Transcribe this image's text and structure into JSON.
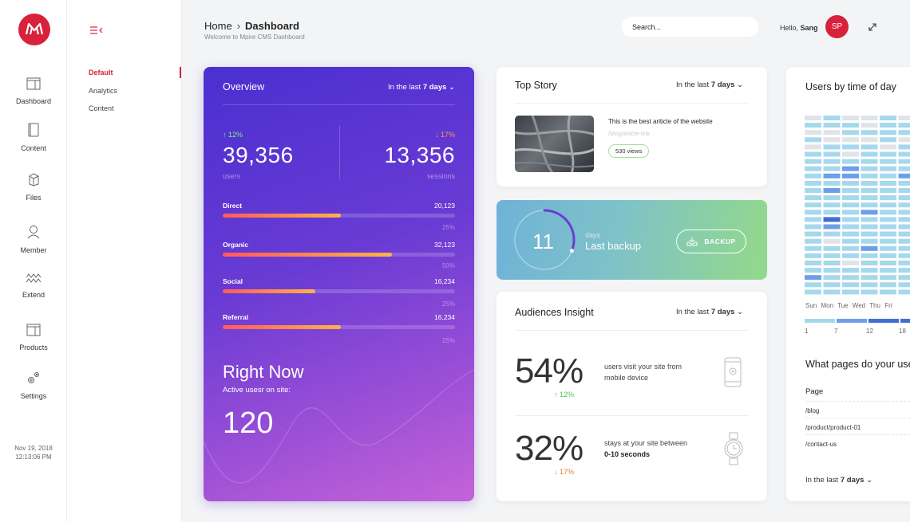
{
  "brand": {
    "accent": "#d8213b"
  },
  "rail": {
    "items": [
      {
        "label": "Dashboard",
        "icon": "dashboard-icon"
      },
      {
        "label": "Content",
        "icon": "content-icon"
      },
      {
        "label": "Files",
        "icon": "files-icon"
      },
      {
        "label": "Member",
        "icon": "member-icon"
      },
      {
        "label": "Extend",
        "icon": "extend-icon"
      },
      {
        "label": "Products",
        "icon": "products-icon"
      },
      {
        "label": "Settings",
        "icon": "settings-icon"
      }
    ],
    "date": "Nov 19, 2018",
    "time": "12:13:06 PM"
  },
  "submenu": {
    "items": [
      {
        "label": "Default",
        "active": true
      },
      {
        "label": "Analytics",
        "active": false
      },
      {
        "label": "Content",
        "active": false
      }
    ]
  },
  "header": {
    "breadcrumb_home": "Home",
    "breadcrumb_sep": "›",
    "breadcrumb_current": "Dashboard",
    "welcome": "Welcome to Mpire CMS Dashboard",
    "search_placeholder": "Search...",
    "hello_prefix": "Hello,",
    "user_name": "Sang",
    "avatar_initials": "SP"
  },
  "period": {
    "prefix": "In the last",
    "value": "7 days"
  },
  "overview": {
    "title": "Overview",
    "users": {
      "trend": "12%",
      "value": "39,356",
      "label": "users"
    },
    "sessions": {
      "trend": "17%",
      "value": "13,356",
      "label": "sessions"
    },
    "channels": [
      {
        "name": "Direct",
        "value": "20,123",
        "pct": "25%",
        "fill": 0.51
      },
      {
        "name": "Organic",
        "value": "32,123",
        "pct": "50%",
        "fill": 0.73
      },
      {
        "name": "Social",
        "value": "16,234",
        "pct": "25%",
        "fill": 0.4
      },
      {
        "name": "Referral",
        "value": "16,234",
        "pct": "25%",
        "fill": 0.51
      }
    ],
    "right_now_title": "Right Now",
    "right_now_sub": "Active usesr on site:",
    "right_now_value": "120"
  },
  "top_story": {
    "title": "Top Story",
    "headline": "This is the best ariticle of the website",
    "link": "/blog/article-link",
    "views": "530 views"
  },
  "backup": {
    "value": "11",
    "unit": "days",
    "label": "Last backup",
    "button": "BACKUP",
    "progress": 0.31
  },
  "audiences": {
    "title": "Audiences Insight",
    "mobile": {
      "value": "54%",
      "trend": "12%",
      "text_a": "users visit your site from",
      "text_b": "mobile device"
    },
    "stay": {
      "value": "32%",
      "trend": "17%",
      "text_a": "stays at your site between",
      "text_b": "0-10 seconds"
    }
  },
  "users_time": {
    "title": "Users by time of day",
    "days": "Sun Mon Tue Wed Thu Fri",
    "hours": [
      "1",
      "7",
      "12",
      "18"
    ],
    "colors": {
      "none": "#e1e3e6",
      "low": "#a6d8ec",
      "mid": "#6f9ee8",
      "high": "#3f6fd2"
    },
    "grid": [
      [
        "none",
        "low",
        "none",
        "none",
        "low",
        "none"
      ],
      [
        "low",
        "low",
        "low",
        "none",
        "low",
        "low"
      ],
      [
        "none",
        "none",
        "low",
        "low",
        "low",
        "low"
      ],
      [
        "low",
        "none",
        "none",
        "none",
        "low",
        "none"
      ],
      [
        "none",
        "low",
        "low",
        "low",
        "none",
        "low"
      ],
      [
        "low",
        "low",
        "none",
        "low",
        "low",
        "low"
      ],
      [
        "low",
        "low",
        "low",
        "low",
        "low",
        "low"
      ],
      [
        "low",
        "low",
        "mid",
        "low",
        "low",
        "low"
      ],
      [
        "low",
        "mid",
        "mid",
        "low",
        "low",
        "mid"
      ],
      [
        "low",
        "low",
        "low",
        "low",
        "low",
        "low"
      ],
      [
        "low",
        "mid",
        "low",
        "low",
        "low",
        "low"
      ],
      [
        "low",
        "low",
        "low",
        "low",
        "low",
        "low"
      ],
      [
        "low",
        "low",
        "low",
        "low",
        "low",
        "low"
      ],
      [
        "low",
        "low",
        "low",
        "mid",
        "low",
        "low"
      ],
      [
        "low",
        "high",
        "low",
        "low",
        "low",
        "low"
      ],
      [
        "low",
        "mid",
        "low",
        "low",
        "low",
        "low"
      ],
      [
        "low",
        "low",
        "low",
        "low",
        "low",
        "low"
      ],
      [
        "low",
        "none",
        "low",
        "low",
        "low",
        "low"
      ],
      [
        "low",
        "low",
        "low",
        "mid",
        "low",
        "low"
      ],
      [
        "low",
        "low",
        "low",
        "low",
        "low",
        "low"
      ],
      [
        "low",
        "low",
        "none",
        "low",
        "low",
        "low"
      ],
      [
        "low",
        "low",
        "low",
        "low",
        "low",
        "low"
      ],
      [
        "mid",
        "low",
        "low",
        "low",
        "low",
        "low"
      ],
      [
        "low",
        "low",
        "low",
        "low",
        "low",
        "low"
      ],
      [
        "low",
        "low",
        "low",
        "low",
        "low",
        "low"
      ]
    ]
  },
  "pages": {
    "title": "What pages do your use",
    "header": "Page",
    "rows": [
      "/blog",
      "/product/product-01",
      "/contact-us"
    ]
  }
}
